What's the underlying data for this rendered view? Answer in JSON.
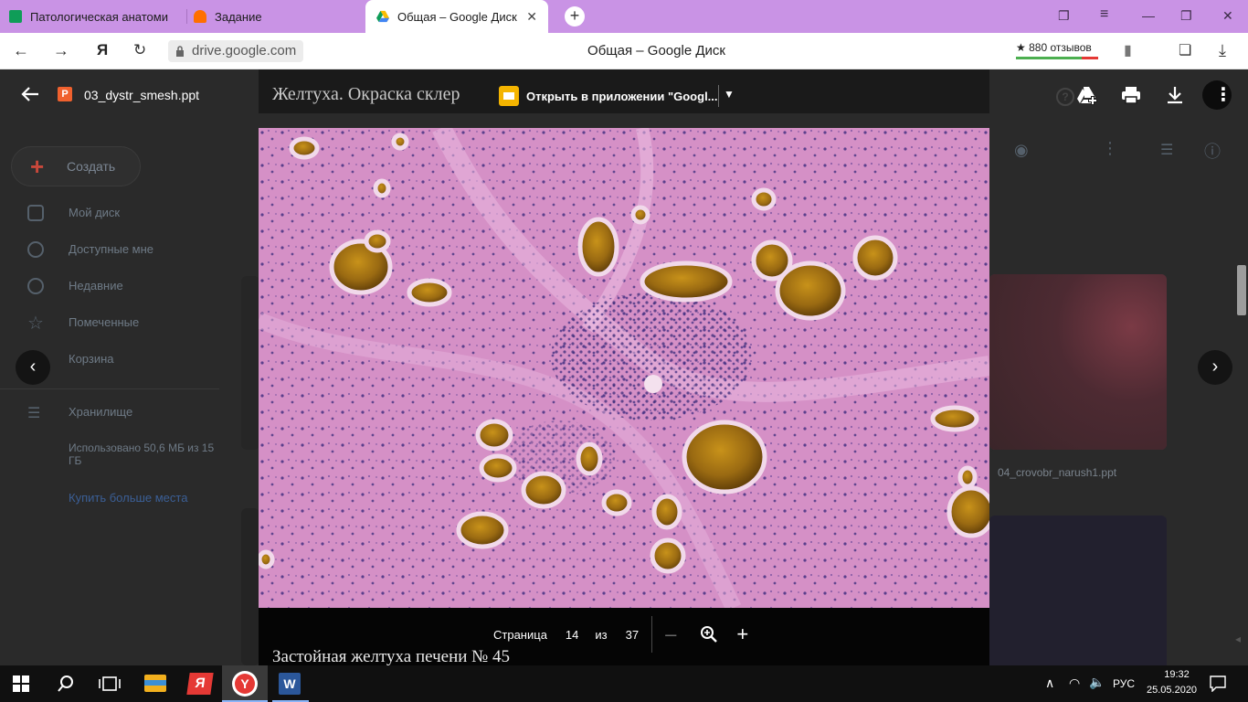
{
  "browser": {
    "tabs": [
      {
        "label": "Патологическая анатоми",
        "favicon_color": "#0f9d58"
      },
      {
        "label": "Задание",
        "favicon_color": "#ff6f00"
      },
      {
        "label": "Общая – Google Диск",
        "favicon_color": "#1a73e8"
      }
    ],
    "url": "drive.google.com",
    "title": "Общая – Google Диск",
    "reviews": "★ 880 отзывов"
  },
  "drive": {
    "create": "Создать",
    "nav": [
      "Мой диск",
      "Доступные мне",
      "Недавние",
      "Помеченные",
      "Корзина"
    ],
    "storage": "Хранилище",
    "used": "Использовано 50,6 МБ из 15 ГБ",
    "buy": "Купить больше места",
    "file_card": "04_crovobr_narush1.ppt"
  },
  "viewer": {
    "file_name": "03_dystr_smesh.ppt",
    "file_badge": "P",
    "open_in_app": "Открыть в приложении \"Googl...",
    "slide_title": "Желтуха. Окраска склер",
    "slide_caption": "Застойная  желтуха печени № 45",
    "page_label": "Страница",
    "page_current": "14",
    "page_of": "из",
    "page_total": "37",
    "zoom_out": "–",
    "zoom_in": "+"
  },
  "taskbar": {
    "lang": "РУС",
    "time": "19:32",
    "date": "25.05.2020"
  },
  "colors": {
    "tabbar": "#c993e5",
    "stain_bg": "#d48fc6",
    "bile": "#9a6a12"
  }
}
